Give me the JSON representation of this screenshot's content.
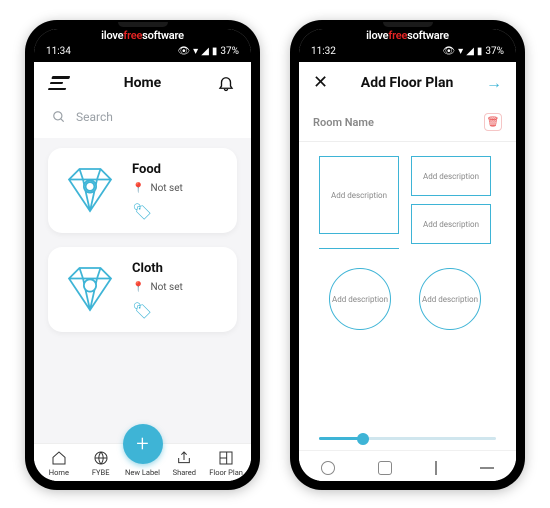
{
  "brand": {
    "pre": "ilove",
    "mid": "free",
    "post": "software"
  },
  "left": {
    "status": {
      "time": "11:34",
      "battery": "37%"
    },
    "header": {
      "title": "Home"
    },
    "search": {
      "placeholder": "Search"
    },
    "cards": [
      {
        "title": "Food",
        "location": "Not set"
      },
      {
        "title": "Cloth",
        "location": "Not set"
      }
    ],
    "nav": {
      "home": "Home",
      "fybe": "FYBE",
      "new": "New Label",
      "shared": "Shared",
      "floor": "Floor Plan"
    }
  },
  "right": {
    "status": {
      "time": "11:32",
      "battery": "37%"
    },
    "header": {
      "title": "Add Floor Plan"
    },
    "room_name": "Room Name",
    "desc": "Add description"
  }
}
